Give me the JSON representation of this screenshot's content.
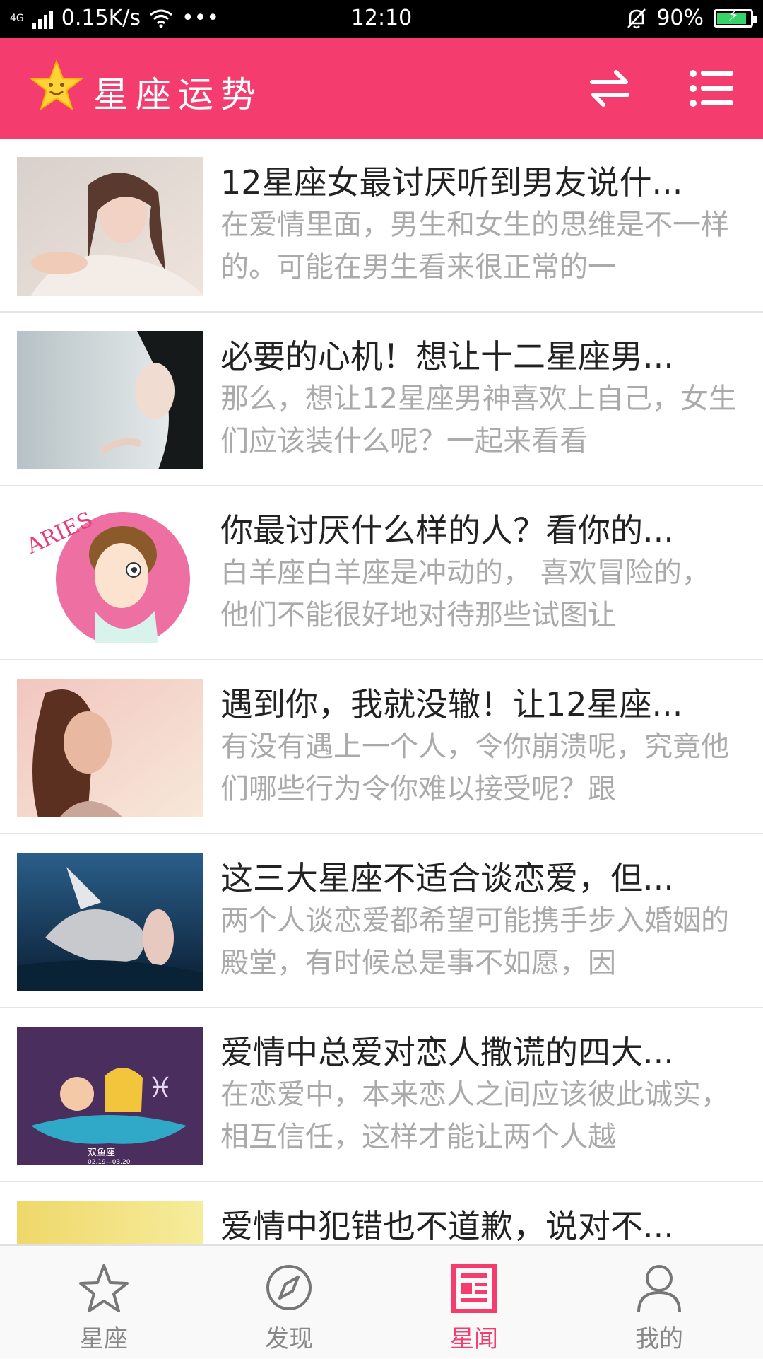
{
  "status_bar": {
    "network": "4G",
    "speed": "0.15K/s",
    "more": "•••",
    "time": "12:10",
    "battery": "90%"
  },
  "header": {
    "title": "星座运势",
    "accent_color": "#f53c6e",
    "icons": [
      "star-logo-icon",
      "swap-icon",
      "menu-icon"
    ]
  },
  "articles": [
    {
      "title": "12星座女最讨厌听到男友说什...",
      "desc": "在爱情里面，男生和女生的思维是不一样的。可能在男生看来很正常的一"
    },
    {
      "title": "必要的心机！想让十二星座男...",
      "desc": "那么，想让12星座男神喜欢上自己，女生们应该装什么呢？一起来看看"
    },
    {
      "title": "你最讨厌什么样的人？看你的...",
      "desc": "白羊座白羊座是冲动的， 喜欢冒险的， 他们不能很好地对待那些试图让",
      "image_text": "ARIES"
    },
    {
      "title": "遇到你，我就没辙！让12星座...",
      "desc": "有没有遇上一个人，令你崩溃呢，究竟他们哪些行为令你难以接受呢？跟"
    },
    {
      "title": "这三大星座不适合谈恋爱，但...",
      "desc": "两个人谈恋爱都希望可能携手步入婚姻的殿堂，有时候总是事不如愿，因"
    },
    {
      "title": "爱情中总爱对恋人撒谎的四大...",
      "desc": "在恋爱中，本来恋人之间应该彼此诚实，相互信任，这样才能让两个人越",
      "image_text": "双鱼座",
      "image_subtext": "02.19—03.20"
    },
    {
      "title": "爱情中犯错也不道歉，说对不...",
      "desc": ""
    }
  ],
  "bottom_nav": [
    {
      "label": "星座",
      "icon": "star-icon",
      "active": false
    },
    {
      "label": "发现",
      "icon": "compass-icon",
      "active": false
    },
    {
      "label": "星闻",
      "icon": "news-icon",
      "active": true
    },
    {
      "label": "我的",
      "icon": "person-icon",
      "active": false
    }
  ]
}
